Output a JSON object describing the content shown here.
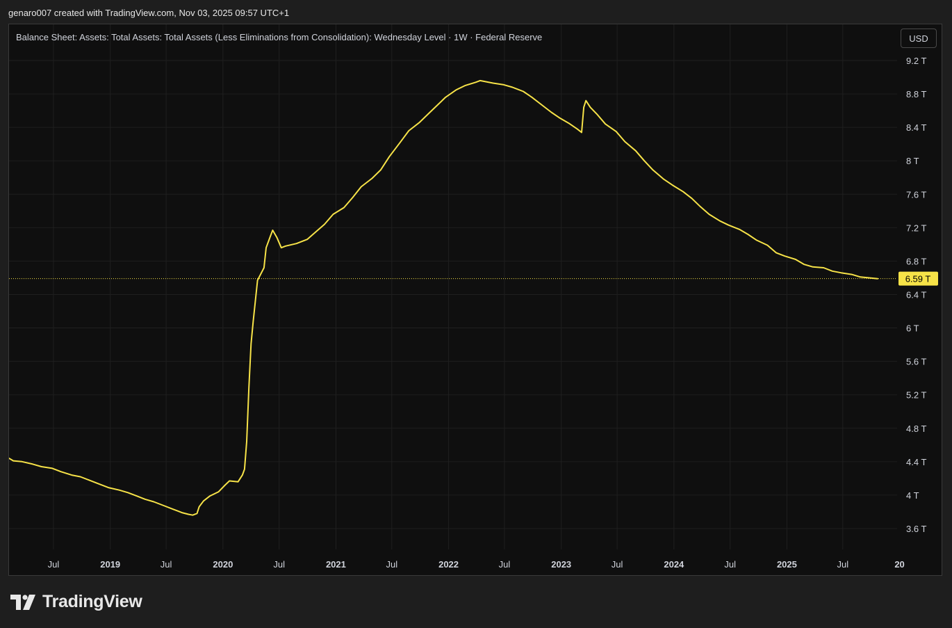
{
  "header": {
    "caption": "genaro007 created with TradingView.com, Nov 03, 2025 09:57 UTC+1"
  },
  "chart_header": {
    "series_title": "Balance Sheet: Assets: Total Assets: Total Assets (Less Eliminations from Consolidation): Wednesday Level · 1W · Federal Reserve",
    "currency_label": "USD"
  },
  "brand": {
    "name": "TradingView",
    "logo_icon": "tradingview-logo-icon"
  },
  "colors": {
    "background": "#0f0f0f",
    "line": "#f7e348",
    "grid": "#1f1f1f",
    "axis_text": "#d1d4dc",
    "price_badge": "#f7e348",
    "price_badge_text": "#000000"
  },
  "chart_data": {
    "type": "line",
    "title": "Balance Sheet: Assets: Total Assets: Total Assets (Less Eliminations from Consolidation): Wednesday Level · 1W · Federal Reserve",
    "xlabel": "",
    "ylabel": "",
    "unit": "T",
    "xlim": [
      "2018-02-07",
      "2025-12-24"
    ],
    "ylim": [
      3.35,
      9.3
    ],
    "grid": true,
    "y_ticks": [
      3.6,
      4.0,
      4.4,
      4.8,
      5.2,
      5.6,
      6.0,
      6.4,
      6.8,
      7.2,
      7.6,
      8.0,
      8.4,
      8.8,
      9.2
    ],
    "y_tick_labels": [
      "3.6 T",
      "4 T",
      "4.4 T",
      "4.8 T",
      "5.2 T",
      "5.6 T",
      "6 T",
      "6.4 T",
      "6.8 T",
      "7.2 T",
      "7.6 T",
      "8 T",
      "8.4 T",
      "8.8 T",
      "9.2 T"
    ],
    "x_ticks": [
      {
        "date": "2018-07-01",
        "label": "Jul",
        "bold": false
      },
      {
        "date": "2019-01-01",
        "label": "2019",
        "bold": true
      },
      {
        "date": "2019-07-01",
        "label": "Jul",
        "bold": false
      },
      {
        "date": "2020-01-01",
        "label": "2020",
        "bold": true
      },
      {
        "date": "2020-07-01",
        "label": "Jul",
        "bold": false
      },
      {
        "date": "2021-01-01",
        "label": "2021",
        "bold": true
      },
      {
        "date": "2021-07-01",
        "label": "Jul",
        "bold": false
      },
      {
        "date": "2022-01-01",
        "label": "2022",
        "bold": true
      },
      {
        "date": "2022-07-01",
        "label": "Jul",
        "bold": false
      },
      {
        "date": "2023-01-01",
        "label": "2023",
        "bold": true
      },
      {
        "date": "2023-07-01",
        "label": "Jul",
        "bold": false
      },
      {
        "date": "2024-01-01",
        "label": "2024",
        "bold": true
      },
      {
        "date": "2024-07-01",
        "label": "Jul",
        "bold": false
      },
      {
        "date": "2025-01-01",
        "label": "2025",
        "bold": true
      },
      {
        "date": "2025-07-01",
        "label": "Jul",
        "bold": false
      },
      {
        "date": "2026-01-01",
        "label": "20",
        "bold": true
      }
    ],
    "last_value": 6.59,
    "last_value_label": "6.59 T",
    "series": [
      {
        "points": [
          [
            "2018-02-07",
            4.44
          ],
          [
            "2018-02-21",
            4.41
          ],
          [
            "2018-03-21",
            4.4
          ],
          [
            "2018-04-25",
            4.37
          ],
          [
            "2018-05-23",
            4.34
          ],
          [
            "2018-06-27",
            4.32
          ],
          [
            "2018-07-25",
            4.28
          ],
          [
            "2018-08-29",
            4.24
          ],
          [
            "2018-09-26",
            4.22
          ],
          [
            "2018-10-24",
            4.18
          ],
          [
            "2018-11-28",
            4.13
          ],
          [
            "2018-12-26",
            4.09
          ],
          [
            "2019-01-30",
            4.06
          ],
          [
            "2019-02-27",
            4.03
          ],
          [
            "2019-03-27",
            3.99
          ],
          [
            "2019-04-24",
            3.95
          ],
          [
            "2019-05-22",
            3.92
          ],
          [
            "2019-06-26",
            3.87
          ],
          [
            "2019-07-24",
            3.83
          ],
          [
            "2019-08-21",
            3.79
          ],
          [
            "2019-09-11",
            3.77
          ],
          [
            "2019-09-25",
            3.76
          ],
          [
            "2019-10-09",
            3.78
          ],
          [
            "2019-10-16",
            3.86
          ],
          [
            "2019-10-30",
            3.93
          ],
          [
            "2019-11-20",
            3.99
          ],
          [
            "2019-12-18",
            4.04
          ],
          [
            "2020-01-08",
            4.12
          ],
          [
            "2020-01-22",
            4.17
          ],
          [
            "2020-02-19",
            4.16
          ],
          [
            "2020-03-04",
            4.24
          ],
          [
            "2020-03-11",
            4.31
          ],
          [
            "2020-03-18",
            4.64
          ],
          [
            "2020-03-25",
            5.29
          ],
          [
            "2020-04-01",
            5.81
          ],
          [
            "2020-04-08",
            6.08
          ],
          [
            "2020-04-22",
            6.57
          ],
          [
            "2020-05-13",
            6.72
          ],
          [
            "2020-05-20",
            6.96
          ],
          [
            "2020-06-03",
            7.1
          ],
          [
            "2020-06-10",
            7.17
          ],
          [
            "2020-06-24",
            7.08
          ],
          [
            "2020-07-08",
            6.96
          ],
          [
            "2020-07-22",
            6.98
          ],
          [
            "2020-08-26",
            7.01
          ],
          [
            "2020-09-30",
            7.06
          ],
          [
            "2020-10-28",
            7.15
          ],
          [
            "2020-11-25",
            7.24
          ],
          [
            "2020-12-23",
            7.36
          ],
          [
            "2021-01-27",
            7.44
          ],
          [
            "2021-02-24",
            7.56
          ],
          [
            "2021-03-24",
            7.69
          ],
          [
            "2021-04-28",
            7.79
          ],
          [
            "2021-05-26",
            7.89
          ],
          [
            "2021-06-23",
            8.05
          ],
          [
            "2021-07-28",
            8.22
          ],
          [
            "2021-08-25",
            8.36
          ],
          [
            "2021-09-29",
            8.46
          ],
          [
            "2021-10-27",
            8.56
          ],
          [
            "2021-11-24",
            8.66
          ],
          [
            "2021-12-22",
            8.76
          ],
          [
            "2022-01-26",
            8.85
          ],
          [
            "2022-02-23",
            8.9
          ],
          [
            "2022-03-30",
            8.94
          ],
          [
            "2022-04-13",
            8.96
          ],
          [
            "2022-05-25",
            8.93
          ],
          [
            "2022-06-29",
            8.91
          ],
          [
            "2022-07-27",
            8.88
          ],
          [
            "2022-08-31",
            8.83
          ],
          [
            "2022-09-28",
            8.76
          ],
          [
            "2022-10-26",
            8.68
          ],
          [
            "2022-11-30",
            8.58
          ],
          [
            "2022-12-28",
            8.51
          ],
          [
            "2023-01-25",
            8.45
          ],
          [
            "2023-02-22",
            8.38
          ],
          [
            "2023-03-08",
            8.34
          ],
          [
            "2023-03-15",
            8.64
          ],
          [
            "2023-03-22",
            8.72
          ],
          [
            "2023-04-05",
            8.64
          ],
          [
            "2023-04-26",
            8.56
          ],
          [
            "2023-05-24",
            8.44
          ],
          [
            "2023-06-28",
            8.35
          ],
          [
            "2023-07-26",
            8.23
          ],
          [
            "2023-08-30",
            8.12
          ],
          [
            "2023-09-27",
            8.0
          ],
          [
            "2023-10-25",
            7.89
          ],
          [
            "2023-11-29",
            7.78
          ],
          [
            "2023-12-27",
            7.71
          ],
          [
            "2024-01-31",
            7.63
          ],
          [
            "2024-02-28",
            7.55
          ],
          [
            "2024-03-27",
            7.45
          ],
          [
            "2024-04-24",
            7.36
          ],
          [
            "2024-05-29",
            7.28
          ],
          [
            "2024-06-26",
            7.23
          ],
          [
            "2024-07-31",
            7.18
          ],
          [
            "2024-08-28",
            7.12
          ],
          [
            "2024-09-25",
            7.05
          ],
          [
            "2024-10-30",
            6.99
          ],
          [
            "2024-11-27",
            6.9
          ],
          [
            "2024-12-25",
            6.86
          ],
          [
            "2025-01-29",
            6.82
          ],
          [
            "2025-02-26",
            6.76
          ],
          [
            "2025-03-26",
            6.73
          ],
          [
            "2025-04-30",
            6.72
          ],
          [
            "2025-05-28",
            6.68
          ],
          [
            "2025-06-25",
            6.66
          ],
          [
            "2025-07-30",
            6.64
          ],
          [
            "2025-08-27",
            6.61
          ],
          [
            "2025-09-24",
            6.6
          ],
          [
            "2025-10-22",
            6.59
          ]
        ]
      }
    ]
  }
}
